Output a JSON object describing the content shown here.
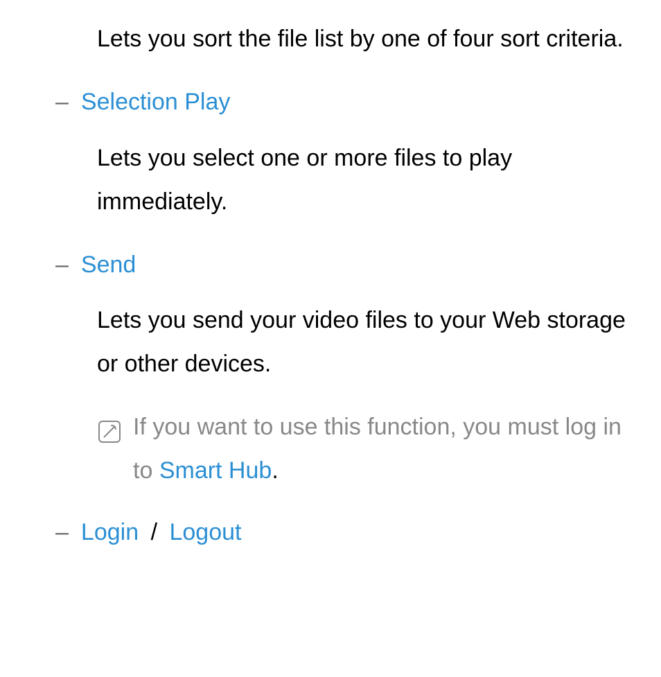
{
  "intro_description": "Lets you sort the file list by one of four sort criteria.",
  "items": [
    {
      "title": "Selection Play",
      "description": "Lets you select one or more files to play immediately."
    },
    {
      "title": "Send",
      "description": "Lets you send your video files to your Web storage or other devices.",
      "note_prefix": "If you want to use this function, you must log in to ",
      "note_highlight": "Smart Hub",
      "note_suffix": "."
    }
  ],
  "login": {
    "login_label": "Login",
    "separator": "/",
    "logout_label": "Logout"
  }
}
